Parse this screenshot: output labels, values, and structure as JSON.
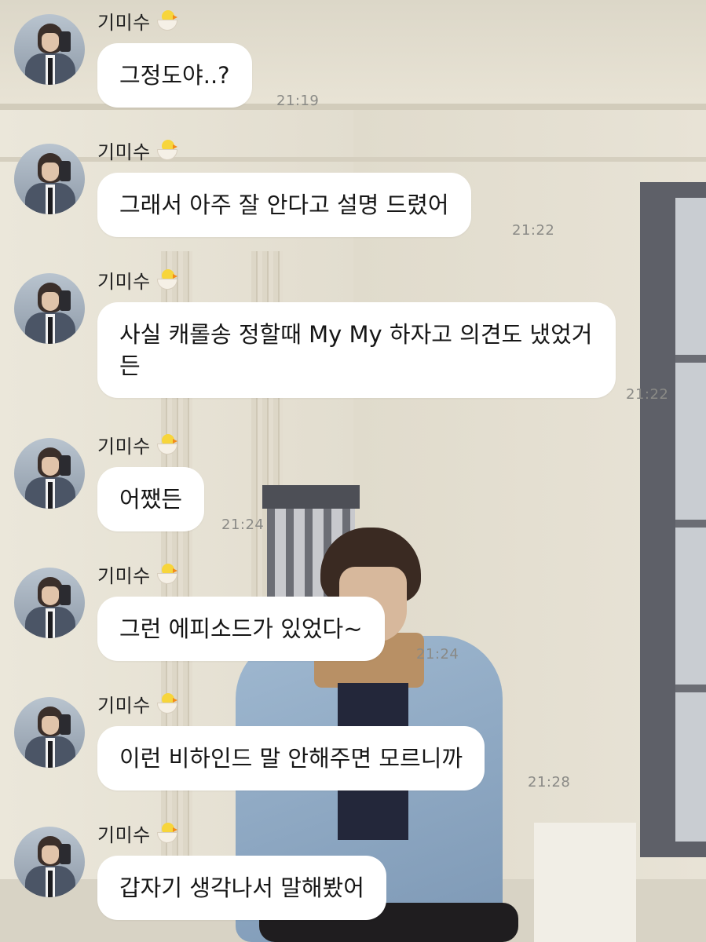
{
  "sender": {
    "name": "기미수",
    "badge_icon": "hatching-chick-icon"
  },
  "messages": [
    {
      "text": "그정도야..?",
      "time": "21:19"
    },
    {
      "text": "그래서 아주 잘 안다고 설명 드렸어",
      "time": "21:22"
    },
    {
      "text": "사실 캐롤송 정할때 My My 하자고 의견도 냈었거든",
      "time": "21:22"
    },
    {
      "text": "어쨌든",
      "time": "21:24"
    },
    {
      "text": "그런 에피소드가 있었다~",
      "time": "21:24"
    },
    {
      "text": "이런 비하인드 말 안해주면 모르니까",
      "time": "21:28"
    },
    {
      "text": "갑자기 생각나서 말해봤어",
      "time": ""
    }
  ]
}
